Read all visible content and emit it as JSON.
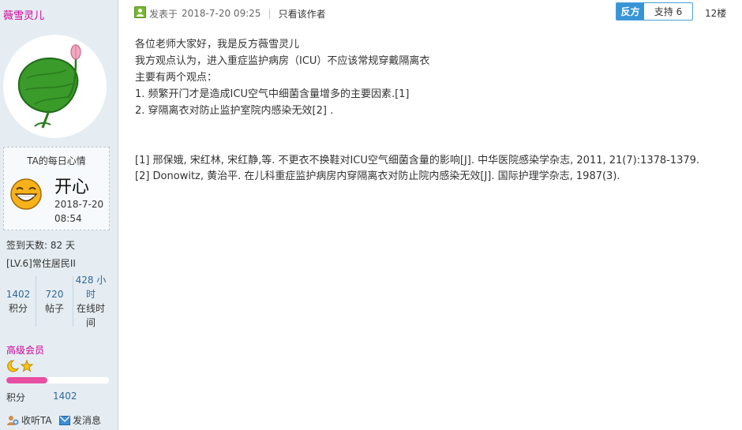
{
  "author": {
    "name": "薇雪灵儿"
  },
  "mood": {
    "title": "TA的每日心情",
    "text": "开心",
    "date": "2018-7-20",
    "time": "08:54"
  },
  "profile": {
    "signin_days": "签到天数: 82 天",
    "level": "[LV.6]常住居民II",
    "stats": [
      {
        "value": "1402",
        "label": "积分"
      },
      {
        "value": "720",
        "label": "帖子"
      },
      {
        "value": "428 小时",
        "label": "在线时间"
      }
    ],
    "membership": "高级会员",
    "membership_progress": 0.4,
    "points_label": "积分",
    "points_value": "1402",
    "follow_label": "收听TA",
    "message_label": "发消息"
  },
  "post": {
    "posted_prefix": "发表于",
    "posted_at": "2018-7-20 09:25",
    "only_author": "只看该作者",
    "side": "反方",
    "support_label": "支持 6",
    "floor": "12楼",
    "lines": [
      "各位老师大家好，我是反方薇雪灵儿",
      "我方观点认为，进入重症监护病房（ICU）不应该常规穿戴隔离衣",
      "主要有两个观点：",
      "1. 频繁开门才是造成ICU空气中细菌含量增多的主要因素.[1]",
      "2. 穿隔离衣对防止监护室院内感染无效[2] ."
    ],
    "references": [
      "[1] 邢保娥, 宋红林, 宋红静,等. 不更衣不换鞋对ICU空气细菌含量的影响[J]. 中华医院感染学杂志, 2011, 21(7):1378-1379.",
      "[2] Donowitz, 黄治平. 在儿科重症监护病房内穿隔离衣对防止院内感染无效[J]. 国际护理学杂志, 1987(3)."
    ]
  },
  "colors": {
    "sidebar_bg": "#e5edf2",
    "username": "#cc0099",
    "stat_number": "#336699",
    "side_tag": "#3895d5",
    "progress": "#e84fa1"
  }
}
